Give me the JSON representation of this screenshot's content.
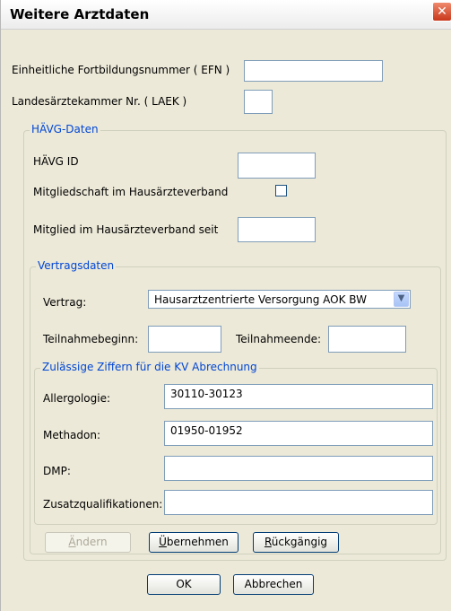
{
  "window": {
    "title": "Weitere Arztdaten",
    "close_glyph": "✕"
  },
  "fields": {
    "efn_label": "Einheitliche Fortbildungsnummer ( EFN )",
    "efn_value": "",
    "laek_label": "Landesärztekammer Nr. ( LAEK )",
    "laek_value": ""
  },
  "haevg": {
    "legend": "HÄVG-Daten",
    "id_label": "HÄVG ID",
    "id_value": "",
    "membership_label": "Mitgliedschaft im Hausärzteverband",
    "membership_checked": false,
    "member_since_label": "Mitglied im Hausärzteverband seit",
    "member_since_value": ""
  },
  "vertrag": {
    "legend": "Vertragsdaten",
    "vertrag_label": "Vertrag:",
    "vertrag_value": "Hausarztzentrierte Versorgung AOK BW",
    "begin_label": "Teilnahmebeginn:",
    "begin_value": "",
    "end_label": "Teilnahmeende:",
    "end_value": ""
  },
  "ziffern": {
    "legend": "Zulässige Ziffern für die KV Abrechnung",
    "rows": [
      {
        "label": "Allergologie:",
        "value": "30110-30123"
      },
      {
        "label": "Methadon:",
        "value": "01950-01952"
      },
      {
        "label": "DMP:",
        "value": ""
      },
      {
        "label": "Zusatzqualifikationen:",
        "value": ""
      }
    ]
  },
  "buttons": {
    "aendern_first": "Ä",
    "aendern_rest": "ndern",
    "uebernehmen_first": "Ü",
    "uebernehmen_rest": "bernehmen",
    "rueck_first": "R",
    "rueck_rest": "ückgängig",
    "ok": "OK",
    "abbrechen": "Abbrechen"
  },
  "colors": {
    "legend": "#0046d5",
    "dialog_bg": "#ece9d8"
  }
}
